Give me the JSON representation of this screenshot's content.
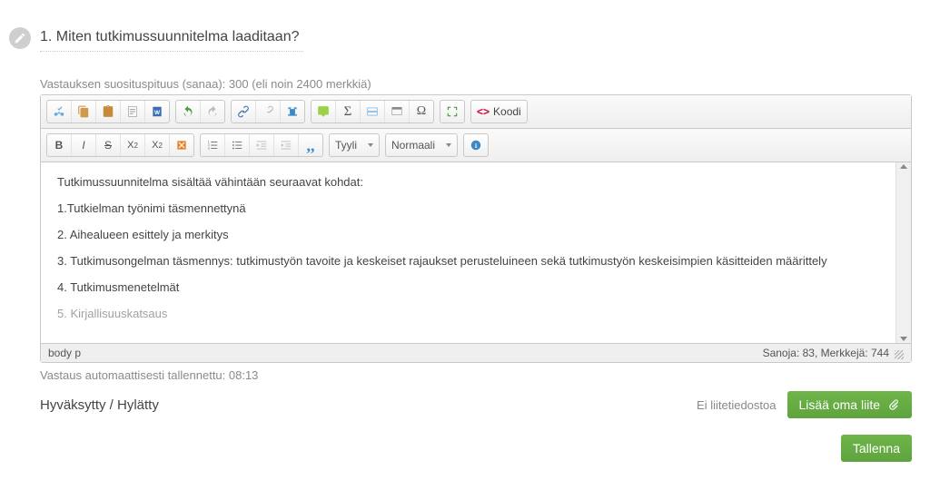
{
  "question": {
    "title": "1. Miten tutkimussuunnitelma laaditaan?",
    "rec_length_label": "Vastauksen suosituspituus (sanaa):",
    "rec_length_value": "300 (eli noin 2400 merkkiä)"
  },
  "toolbar": {
    "style_combo": "Tyyli",
    "format_combo": "Normaali",
    "source_button": "Koodi"
  },
  "editor": {
    "lines": [
      "Tutkimussuunnitelma sisältää vähintään seuraavat kohdat:",
      "1.Tutkielman työnimi täsmennettynä",
      "2. Aihealueen esittely ja merkitys",
      "3. Tutkimusongelman täsmennys: tutkimustyön tavoite ja keskeiset rajaukset perusteluineen sekä tutkimustyön keskeisimpien käsitteiden määrittely",
      "4. Tutkimusmenetelmät",
      "5. Kirjallisuuskatsaus"
    ]
  },
  "status_bar": {
    "path": "body   p",
    "counts": "Sanoja: 83, Merkkejä: 744"
  },
  "autosave": "Vastaus automaattisesti tallennettu: 08:13",
  "footer": {
    "grade": "Hyväksytty / Hylätty",
    "no_attachment": "Ei liitetiedostoa",
    "add_attachment": "Lisää oma liite",
    "save": "Tallenna"
  }
}
